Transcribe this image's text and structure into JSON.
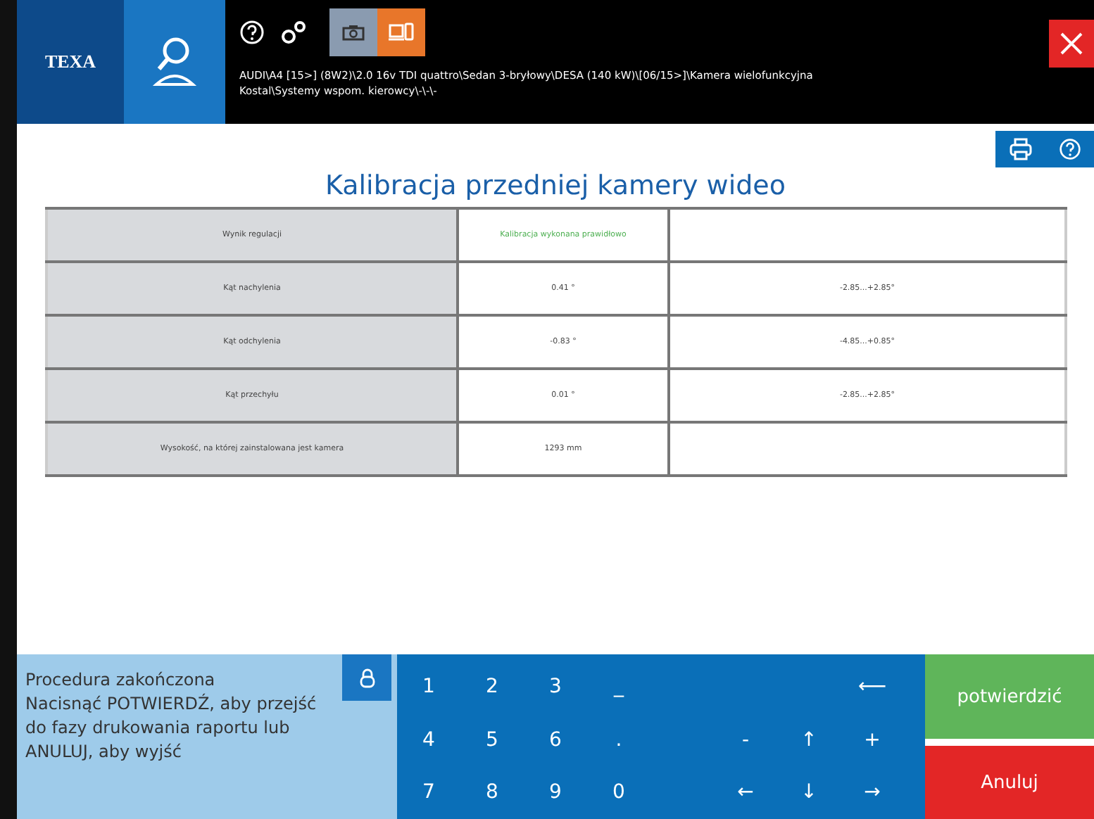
{
  "header": {
    "logo": "TEXA",
    "path": "AUDI\\A4 [15>] (8W2)\\2.0 16v TDI quattro\\Sedan 3-bryłowy\\DESA (140 kW)\\[06/15>]\\Kamera wielofunkcyjna Kostal\\Systemy wspom. kierowcy\\-\\-\\-"
  },
  "title": "Kalibracja przedniej kamery wideo",
  "table": {
    "rows": [
      {
        "label": "Wynik regulacji",
        "value": "Kalibracja wykonana prawidłowo",
        "color": "#4caf50"
      },
      {
        "label": "Kąt nachylenia",
        "value": "0.41 °",
        "color": "#444444",
        "range": "-2.85...+2.85°"
      },
      {
        "label": "Kąt odchylenia",
        "value": "-0.83 °",
        "color": "#444444",
        "range": "-4.85...+0.85°"
      },
      {
        "label": "Kąt przechyłu",
        "value": "0.01 °",
        "color": "#444444",
        "range": "-2.85...+2.85°"
      },
      {
        "label": "Wysokość, na której zainstalowana jest kamera",
        "value": "1293 mm",
        "color": "#444444"
      }
    ]
  },
  "message": [
    "Procedura zakończona",
    "Nacisnąć POTWIERDŹ, aby przejść do fazy drukowania raportu lub ANULUJ, aby wyjść"
  ],
  "keypad": [
    {
      "digits": [
        "1",
        "2",
        "3",
        "_"
      ],
      "arrows": [
        "⟵"
      ]
    },
    {
      "digits": [
        "4",
        "5",
        "6",
        "."
      ],
      "arrows": [
        "-",
        "↑",
        "+"
      ]
    },
    {
      "digits": [
        "7",
        "8",
        "9",
        "0"
      ],
      "arrows": [
        "←",
        "↓",
        "→"
      ]
    }
  ],
  "buttons": {
    "confirm": "potwierdzić",
    "cancel": "Anuluj"
  }
}
